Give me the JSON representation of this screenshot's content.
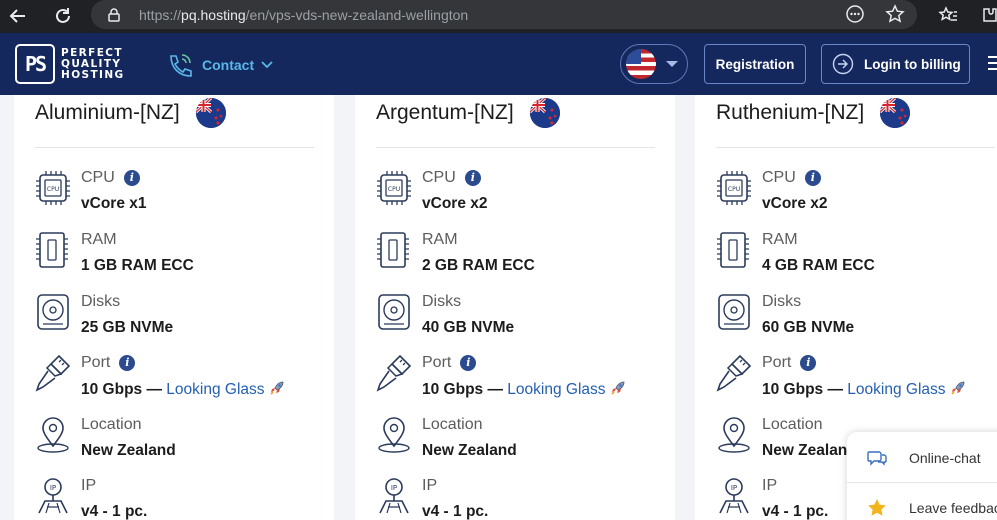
{
  "browser": {
    "url_prefix": "https://",
    "url_host": "pq.hosting",
    "url_path": "/en/vps-vds-new-zealand-wellington"
  },
  "header": {
    "logo_mark": "PS",
    "logo_lines": [
      "PERFECT",
      "QUALITY",
      "HOSTING"
    ],
    "contact_label": "Contact",
    "registration_label": "Registration",
    "login_label": "Login to billing"
  },
  "labels": {
    "cpu": "CPU",
    "ram": "RAM",
    "disks": "Disks",
    "port": "Port",
    "location": "Location",
    "ip": "IP"
  },
  "cards": [
    {
      "title": "Aluminium-[NZ]",
      "cpu": "vCore x1",
      "ram": "1 GB RAM ECC",
      "disks": "25 GB NVMe",
      "port": "10 Gbps —",
      "port_link": "Looking Glass",
      "location": "New Zealand",
      "ip": "v4 - 1 pc."
    },
    {
      "title": "Argentum-[NZ]",
      "cpu": "vCore x2",
      "ram": "2 GB RAM ECC",
      "disks": "40 GB NVMe",
      "port": "10 Gbps —",
      "port_link": "Looking Glass",
      "location": "New Zealand",
      "ip": "v4 - 1 pc."
    },
    {
      "title": "Ruthenium-[NZ]",
      "cpu": "vCore x2",
      "ram": "4 GB RAM ECC",
      "disks": "60 GB NVMe",
      "port": "10 Gbps —",
      "port_link": "Looking Glass",
      "location": "New Zealand",
      "ip": "v4 - 1 pc."
    }
  ],
  "widget": {
    "online_chat": "Online-chat",
    "leave_feedback": "Leave feedback"
  },
  "colors": {
    "header_bg": "#14285e",
    "accent_link": "#2560b0",
    "contact_blue": "#58b8e8"
  }
}
